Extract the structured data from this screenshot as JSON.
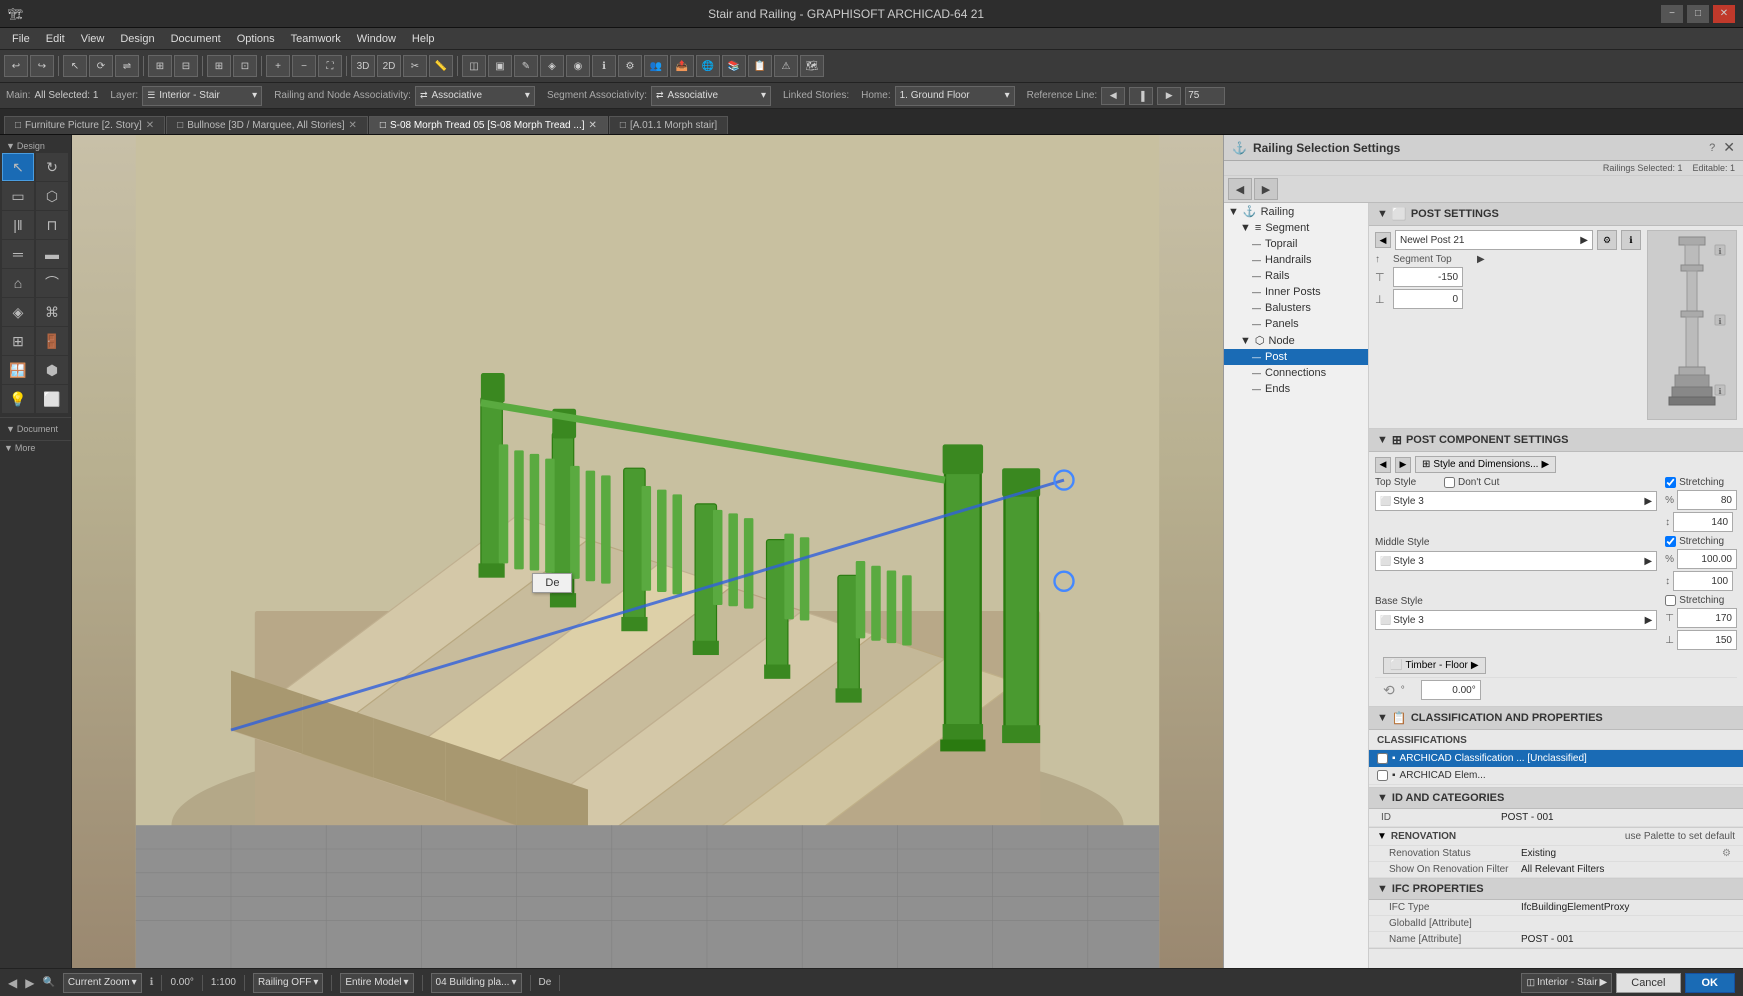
{
  "window": {
    "title": "Stair and Railing - GRAPHISOFT ARCHICAD-64 21",
    "minimize_label": "−",
    "maximize_label": "□",
    "close_label": "✕"
  },
  "menu": {
    "items": [
      "File",
      "Edit",
      "View",
      "Design",
      "Document",
      "Options",
      "Teamwork",
      "Window",
      "Help"
    ]
  },
  "context_bar": {
    "main_label": "Main:",
    "all_selected": "All Selected: 1",
    "layer_label": "Layer:",
    "layer_value": "Interior - Stair",
    "railing_assoc_label": "Railing and Node Associativity:",
    "railing_assoc_value": "Associative",
    "segment_assoc_label": "Segment Associativity:",
    "segment_assoc_value": "Associative",
    "linked_stories_label": "Linked Stories:",
    "home_label": "Home:",
    "home_value": "1. Ground Floor",
    "reference_line_label": "Reference Line:",
    "reference_line_value": "75"
  },
  "tabs": [
    {
      "label": "Furniture Picture [2. Story]",
      "icon": "□",
      "closable": true
    },
    {
      "label": "Bullnose [3D / Marquee, All Stories]",
      "icon": "□",
      "closable": true
    },
    {
      "label": "S-08 Morph Tread 05 [S-08 Morph Tread ...]",
      "icon": "□",
      "closable": true
    },
    {
      "label": "[A.01.1 Morph stair]",
      "icon": "□",
      "closable": true
    }
  ],
  "toolbox": {
    "design_label": "Design",
    "more_label": "More",
    "tools": [
      "↖",
      "□",
      "▭",
      "⬡",
      "○",
      "⌒",
      "⌀",
      "⋀",
      "⬜",
      "⊞",
      "⬢",
      "▲",
      "⬣",
      "⊙",
      "⊚",
      "⊛",
      "⊠",
      "⊡"
    ]
  },
  "railing_settings": {
    "title": "Railing Selection Settings",
    "railings_selected": "Railings Selected: 1",
    "editable": "Editable: 1",
    "close_btn": "✕",
    "help_btn": "?",
    "post_settings_header": "POST SETTINGS",
    "newel_post_label": "Newel Post 21",
    "segment_top_label": "Segment Top",
    "value_neg150": "-150",
    "value_0": "0",
    "post_component_header": "POST COMPONENT SETTINGS",
    "style_dimensions_label": "Style and Dimensions...",
    "top_style_label": "Top Style",
    "top_style_value": "Style 3",
    "dont_cut_label": "Don't Cut",
    "stretching_label": "Stretching",
    "val_80": "80",
    "val_140": "140",
    "middle_style_label": "Middle Style",
    "middle_style_value": "Style 3",
    "stretching2_label": "Stretching",
    "val_100_pct": "100.00",
    "val_100": "100",
    "base_style_label": "Base Style",
    "base_style_value": "Style 3",
    "val_170": "170",
    "val_150": "150",
    "timber_floor_label": "Timber - Floor",
    "angle_value": "0.00°",
    "classification_properties_header": "CLASSIFICATION AND PROPERTIES",
    "classifications_label": "CLASSIFICATIONS",
    "archicad_class1": "ARCHICAD Classification ... [Unclassified]",
    "archicad_class2": "ARCHICAD Elem...",
    "id_categories_header": "ID AND CATEGORIES",
    "id_label": "ID",
    "id_value": "POST - 001",
    "renovation_label": "RENOVATION",
    "renovation_value": "use Palette to set default",
    "renovation_status_label": "Renovation Status",
    "renovation_status_value": "Existing",
    "show_renovation_label": "Show On Renovation Filter",
    "show_renovation_value": "All Relevant Filters",
    "ifc_properties_header": "IFC PROPERTIES",
    "ifc_type_label": "IFC Type",
    "ifc_type_value": "IfcBuildingElementProxy",
    "global_id_label": "GlobalId [Attribute]",
    "name_label": "Name [Attribute]",
    "name_value": "POST - 001"
  },
  "tree": {
    "items": [
      {
        "label": "Railing",
        "level": 0,
        "icon": "▶"
      },
      {
        "label": "Segment",
        "level": 1,
        "icon": "▶"
      },
      {
        "label": "Toprail",
        "level": 2,
        "icon": "—"
      },
      {
        "label": "Handrails",
        "level": 2,
        "icon": "—"
      },
      {
        "label": "Rails",
        "level": 2,
        "icon": "—"
      },
      {
        "label": "Inner Posts",
        "level": 2,
        "icon": "—"
      },
      {
        "label": "Balusters",
        "level": 2,
        "icon": "—"
      },
      {
        "label": "Panels",
        "level": 2,
        "icon": "—"
      },
      {
        "label": "Node",
        "level": 1,
        "icon": "▶"
      },
      {
        "label": "Post",
        "level": 2,
        "icon": "—",
        "selected": true
      },
      {
        "label": "Connections",
        "level": 2,
        "icon": "—"
      },
      {
        "label": "Ends",
        "level": 2,
        "icon": "—"
      }
    ]
  },
  "status_bar": {
    "nav_prev": "◀",
    "nav_next": "▶",
    "zoom_icon": "🔍",
    "current_zoom": "Current Zoom",
    "angle": "0.00°",
    "scale": "1:100",
    "railing_off": "Railing OFF",
    "entire_model": "Entire Model",
    "building_plan": "04 Building pla...",
    "de_label": "De",
    "interior_stair": "Interior - Stair",
    "cancel_label": "Cancel",
    "ok_label": "OK"
  }
}
